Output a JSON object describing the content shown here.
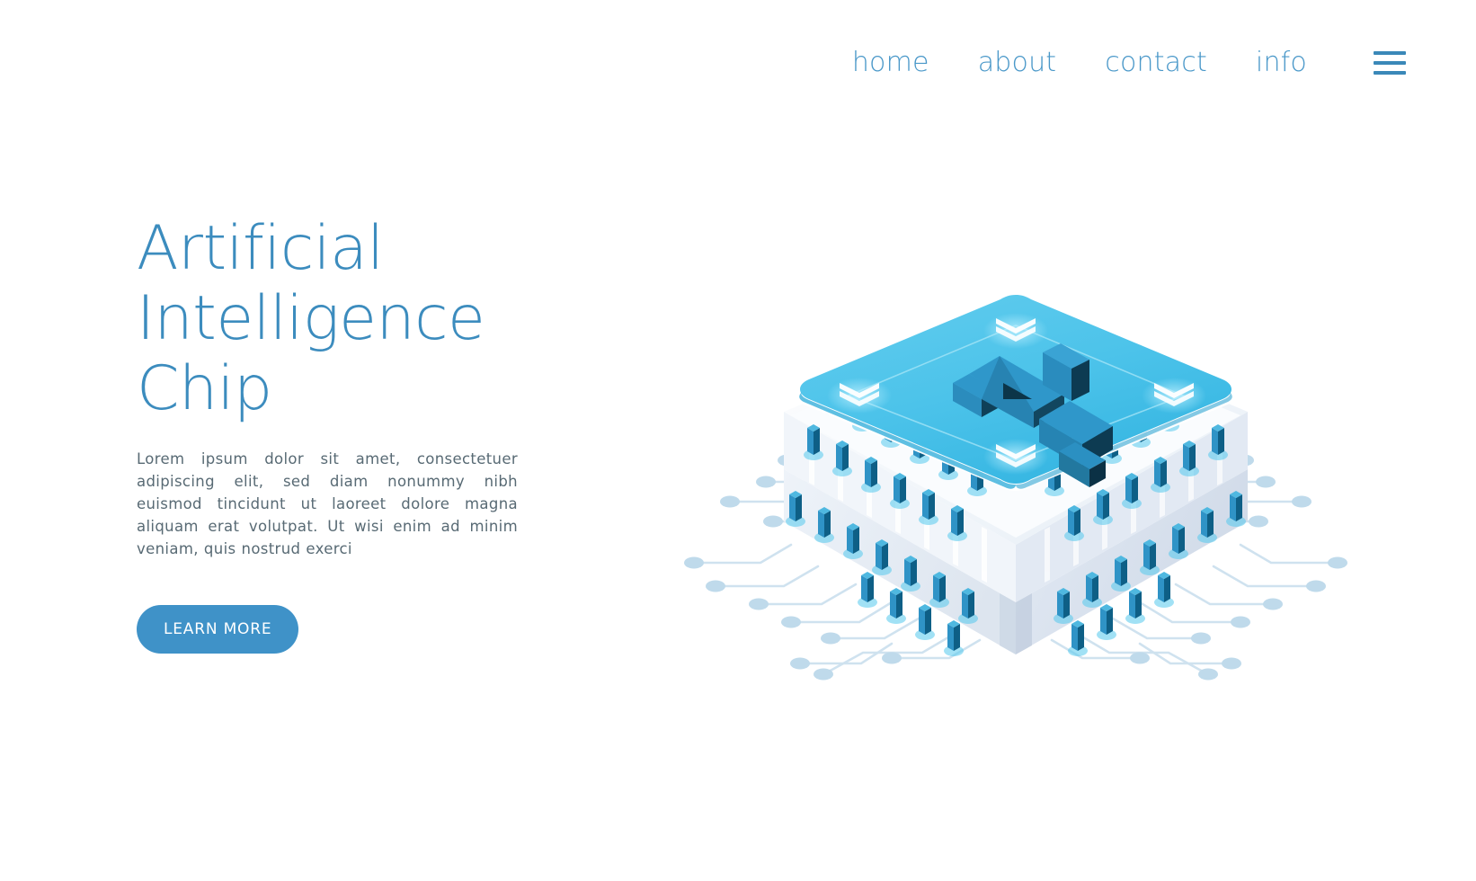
{
  "nav": {
    "items": [
      {
        "label": "home",
        "name": "nav-link-home"
      },
      {
        "label": "about",
        "name": "nav-link-about"
      },
      {
        "label": "contact",
        "name": "nav-link-contact"
      },
      {
        "label": "info",
        "name": "nav-link-info"
      }
    ],
    "menu_icon": "hamburger-menu-icon",
    "link_color": "#4a98c9",
    "menu_icon_color": "#3a88b8"
  },
  "hero": {
    "title": "Artificial\nIntelligence\nChip",
    "title_color": "#3c8cbe",
    "paragraph": "Lorem ipsum dolor sit amet, consectetuer adipiscing elit, sed diam nonummy nibh euismod tincidunt ut laoreet dolore magna aliquam erat volutpat. Ut wisi enim ad minim veniam, quis nostrud exerci",
    "paragraph_lines": [
      "Lorem ipsum dolor sit amet, consectetuer adipisc-",
      "ing elit, sed diam nonummy nibh euismod tincidunt",
      "ut laoreet dolore magna aliquam erat volutpat.",
      "Ut wisi enim ad minim veniam, quis nostrud exerci"
    ],
    "paragraph_color": "#586a74",
    "cta_label": "LEARN MORE",
    "cta_bg": "#3f92c8",
    "cta_text_color": "#ffffff"
  },
  "illustration": {
    "name": "isometric-ai-chip-illustration",
    "chip_label": "AI",
    "colors": {
      "chip_top": "#4ec6ec",
      "chip_top_dark": "#2fb5e0",
      "chip_rim_light": "#f2f6fa",
      "body_light": "#ffffff",
      "body_mid": "#e4eaf2",
      "body_shade": "#d3dce8",
      "pin_light": "#2b8fc4",
      "pin_dark": "#0d5f87",
      "pin_glow": "#49c4e8",
      "letter_face": "#2b96c9",
      "letter_side": "#0e3d55",
      "letter_top": "#1f7ba8",
      "trace": "#cfe2ef",
      "trace_node": "#bcd9ea"
    },
    "background": "#ffffff"
  }
}
